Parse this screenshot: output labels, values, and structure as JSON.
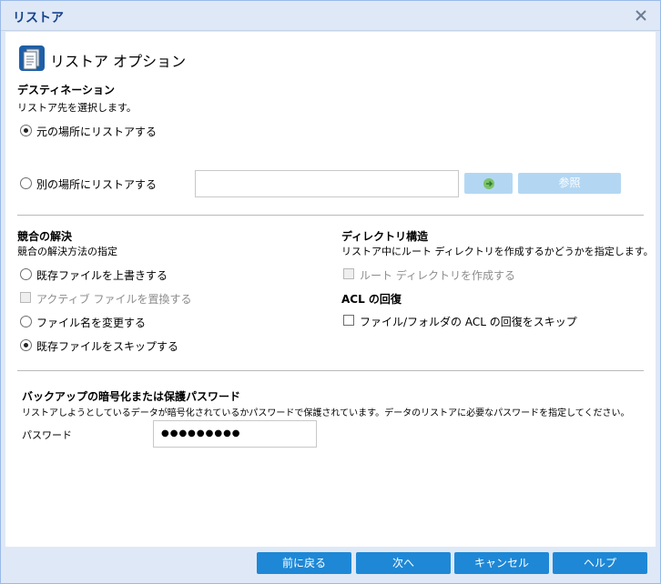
{
  "window": {
    "title": "リストア"
  },
  "header": {
    "title": "リストア オプション"
  },
  "destination": {
    "heading": "デスティネーション",
    "description": "リストア先を選択します。",
    "option_original": "元の場所にリストアする",
    "option_other": "別の場所にリストアする",
    "path_value": "",
    "browse_label": "参照"
  },
  "conflict": {
    "heading": "競合の解決",
    "description": "競合の解決方法の指定",
    "overwrite": "既存ファイルを上書きする",
    "replace_active": "アクティブ ファイルを置換する",
    "rename": "ファイル名を変更する",
    "skip": "既存ファイルをスキップする"
  },
  "directory": {
    "heading": "ディレクトリ構造",
    "description": "リストア中にルート ディレクトリを作成するかどうかを指定します。",
    "create_root": "ルート ディレクトリを作成する"
  },
  "acl": {
    "heading": "ACL の回復",
    "skip_label": "ファイル/フォルダの ACL の回復をスキップ"
  },
  "encryption": {
    "heading": "バックアップの暗号化または保護パスワード",
    "description": "リストアしようとしているデータが暗号化されているかパスワードで保護されています。データのリストアに必要なパスワードを指定してください。",
    "password_label": "パスワード",
    "password_value": "●●●●●●●●●"
  },
  "footer": {
    "back": "前に戻る",
    "next": "次へ",
    "cancel": "キャンセル",
    "help": "ヘルプ"
  },
  "colors": {
    "title": "#15428b",
    "button": "#1e88d6",
    "button_disabled": "#b3d7f3"
  }
}
